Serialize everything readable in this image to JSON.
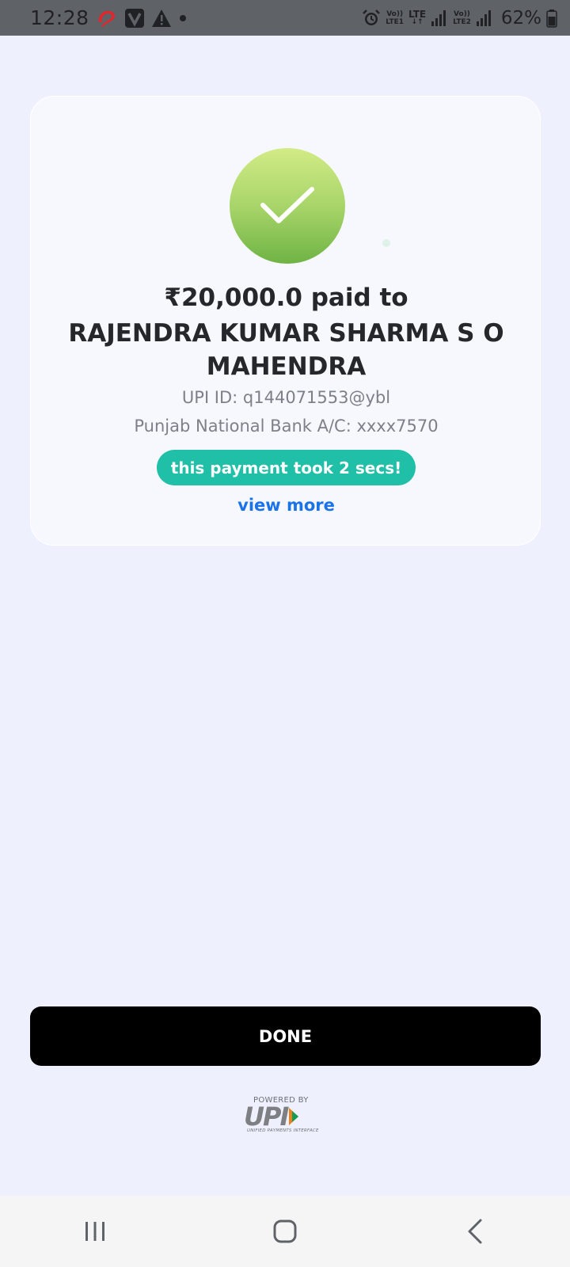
{
  "status_bar": {
    "time": "12:28",
    "left_icons": [
      "airtel-icon",
      "vi-icon",
      "warning-icon",
      "dot-icon"
    ],
    "right_icons": [
      "alarm-icon",
      "volte-lte1-icon",
      "lte-data-icon",
      "signal-icon",
      "volte-lte2-icon",
      "signal-icon",
      "battery-icon"
    ],
    "net1_top": "Vo))",
    "net1_bottom": "LTE1",
    "net_lte": "LTE",
    "net2_top": "Vo))",
    "net2_bottom": "LTE2",
    "battery": "62%"
  },
  "payment": {
    "amount_line": "₹20,000.0 paid to",
    "payee_name": "RAJENDRA KUMAR SHARMA S O MAHENDRA",
    "upi_id": "UPI ID: q144071553@ybl",
    "bank_line": "Punjab National Bank A/C: xxxx7570",
    "speed_badge": "this payment took 2 secs!",
    "view_more": "view more",
    "status_icon": "check-icon",
    "success_color": "#8cc656"
  },
  "actions": {
    "done_label": "DONE"
  },
  "footer": {
    "powered_by": "POWERED BY",
    "logo_text": "UPI",
    "tagline": "UNIFIED PAYMENTS INTERFACE"
  },
  "nav_bar": {
    "buttons": [
      "recent-apps-icon",
      "home-icon",
      "back-icon"
    ]
  },
  "colors": {
    "background": "#eef1fd",
    "badge": "#1fbfa8",
    "link": "#1a73e8",
    "button": "#000000"
  }
}
